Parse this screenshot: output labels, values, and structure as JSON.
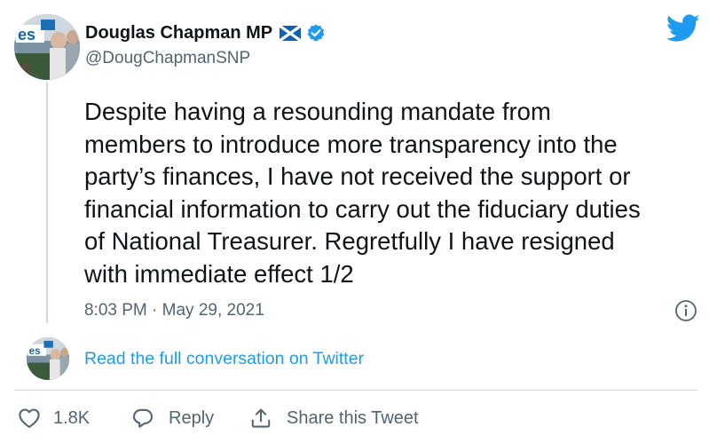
{
  "tweet": {
    "author": {
      "display_name": "Douglas Chapman MP",
      "handle": "@DougChapmanSNP",
      "flag_icon": "scotland-flag-icon",
      "verified_icon": "verified-badge-icon"
    },
    "text": "Despite having a resounding mandate from\nmembers to introduce more transparency into the\nparty’s finances, I have not received the support or\nfinancial information to carry out the fiduciary duties\nof National Treasurer. Regretfully I have resigned\nwith immediate effect 1/2",
    "timestamp": "8:03 PM · May 29, 2021",
    "read_conversation_label": "Read the full conversation on Twitter"
  },
  "actions": {
    "like_count": "1.8K",
    "reply_label": "Reply",
    "share_label": "Share this Tweet"
  },
  "colors": {
    "accent": "#1d9bf0",
    "text_primary": "#0f1419",
    "text_secondary": "#536471",
    "divider": "#cfd9de"
  },
  "icons": {
    "brand": "twitter-bird-icon",
    "info": "info-icon",
    "like": "heart-icon",
    "reply": "speech-bubble-icon",
    "share": "share-upload-icon"
  }
}
